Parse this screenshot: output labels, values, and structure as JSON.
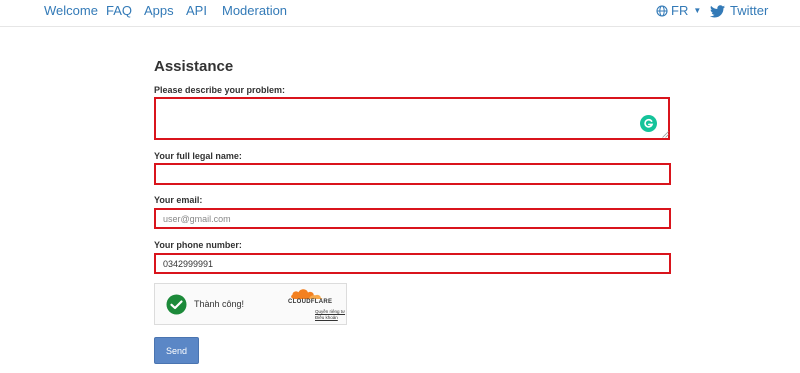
{
  "nav": {
    "links": [
      "Welcome",
      "FAQ",
      "Apps",
      "API",
      "Moderation"
    ],
    "language": "FR",
    "twitter": "Twitter"
  },
  "form": {
    "title": "Assistance",
    "problem_label": "Please describe your problem:",
    "problem_value": "",
    "name_label": "Your full legal name:",
    "name_value": "",
    "email_label": "Your email:",
    "email_placeholder": "user@gmail.com",
    "phone_label": "Your phone number:",
    "phone_value": "0342999991",
    "send_label": "Send"
  },
  "captcha": {
    "status": "Thành công!",
    "brand": "CLOUDFLARE",
    "privacy_link": "Quyền riêng tư",
    "terms_link": "Điều khoản"
  },
  "colors": {
    "link": "#337ab7",
    "field_border": "#d9141c",
    "button": "#5b87c6",
    "success": "#1c8a3a",
    "cloudflare": "#f38020",
    "grammarly": "#15c39a"
  }
}
